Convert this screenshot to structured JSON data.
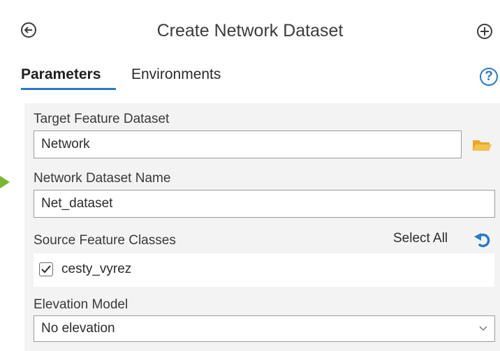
{
  "header": {
    "title": "Create Network Dataset"
  },
  "tabs": [
    {
      "label": "Parameters",
      "active": true
    },
    {
      "label": "Environments",
      "active": false
    }
  ],
  "help": {
    "symbol": "?"
  },
  "params": {
    "target_feature_dataset": {
      "label": "Target Feature Dataset",
      "value": "Network"
    },
    "network_dataset_name": {
      "label": "Network Dataset Name",
      "value": "Net_dataset"
    },
    "source_feature_classes": {
      "label": "Source Feature Classes",
      "select_all": "Select All",
      "items": [
        {
          "label": "cesty_vyrez",
          "checked": true
        }
      ]
    },
    "elevation_model": {
      "label": "Elevation Model",
      "value": "No elevation"
    }
  },
  "colors": {
    "accent": "#2b79c9",
    "folder": "#f2c14e",
    "marker": "#7ab830"
  },
  "icons": [
    "back-arrow-icon",
    "add-icon",
    "help-icon",
    "folder-icon",
    "undo-icon",
    "checkmark-icon",
    "chevron-down-icon"
  ]
}
